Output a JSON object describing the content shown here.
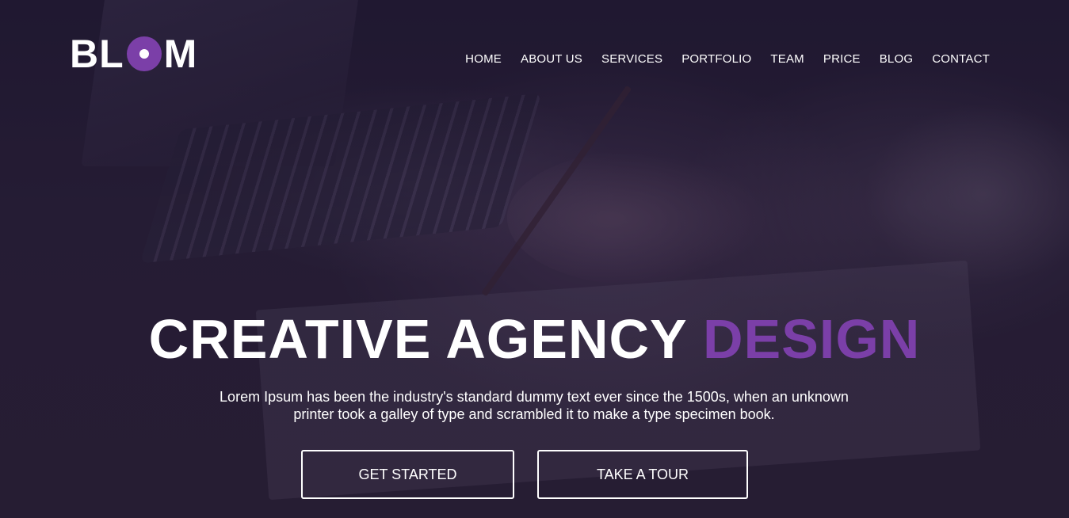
{
  "brand": {
    "logo_left": "BL",
    "logo_right": "M",
    "accent_color": "#7b3fa8"
  },
  "nav": {
    "items": [
      {
        "label": "HOME"
      },
      {
        "label": "ABOUT US"
      },
      {
        "label": "SERVICES"
      },
      {
        "label": "PORTFOLIO"
      },
      {
        "label": "TEAM"
      },
      {
        "label": "PRICE"
      },
      {
        "label": "BLOG"
      },
      {
        "label": "CONTACT"
      }
    ]
  },
  "hero": {
    "headline_main": "CREATIVE AGENCY ",
    "headline_accent": "DESIGN",
    "subtitle_line1": "Lorem Ipsum has been the industry's standard dummy text ever since the 1500s, when an unknown",
    "subtitle_line2": "printer took a galley of type and scrambled it to make a type specimen book.",
    "primary_button": "GET STARTED",
    "secondary_button": "TAKE A TOUR"
  }
}
